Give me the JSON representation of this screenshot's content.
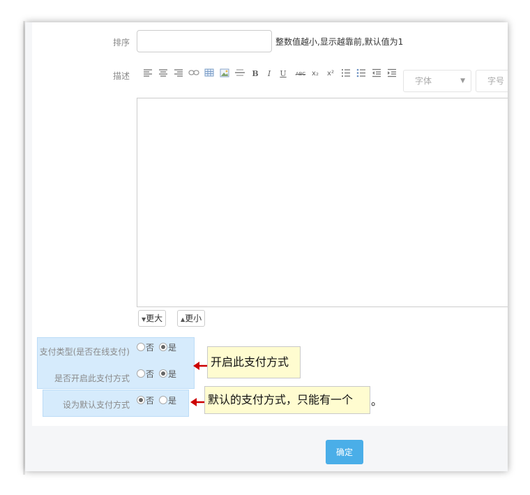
{
  "form": {
    "sort": {
      "label": "排序",
      "value": "",
      "hint": "整数值越小,显示越靠前,默认值为1"
    },
    "description": {
      "label": "描述",
      "toolbar": {
        "font_select": "字体",
        "size_select": "字号",
        "icons": [
          "align-left-icon",
          "align-center-icon",
          "align-right-icon",
          "link-icon",
          "table-icon",
          "image-icon",
          "horizontal-rule-icon",
          "bold-icon",
          "italic-icon",
          "underline-icon",
          "strikethrough-icon",
          "subscript-icon",
          "superscript-icon",
          "ordered-list-icon",
          "unordered-list-icon",
          "outdent-icon",
          "indent-icon"
        ],
        "glyphs": {
          "bold": "B",
          "italic": "I",
          "underline": "U",
          "strike": "ABC",
          "subscript": "x₂",
          "superscript": "x²"
        }
      },
      "enlarge_button": "更大",
      "shrink_button": "更小"
    },
    "pay_type": {
      "label": "支付类型(是否在线支付)",
      "options": [
        "否",
        "是"
      ],
      "selected": "是"
    },
    "enabled": {
      "label": "是否开启此支付方式",
      "options": [
        "否",
        "是"
      ],
      "selected": "是"
    },
    "default": {
      "label": "设为默认支付方式",
      "options": [
        "否",
        "是"
      ],
      "selected": "否"
    },
    "confirm_button": "确定"
  },
  "annotations": {
    "enable_note": "开启此支付方式",
    "default_note": "默认的支付方式，只能有一个",
    "default_note_suffix": "。"
  },
  "colors": {
    "highlight": "#d6ebfc",
    "callout_bg": "#fffcd0",
    "arrow": "#cc0000",
    "confirm_bg": "#4aaee8"
  }
}
